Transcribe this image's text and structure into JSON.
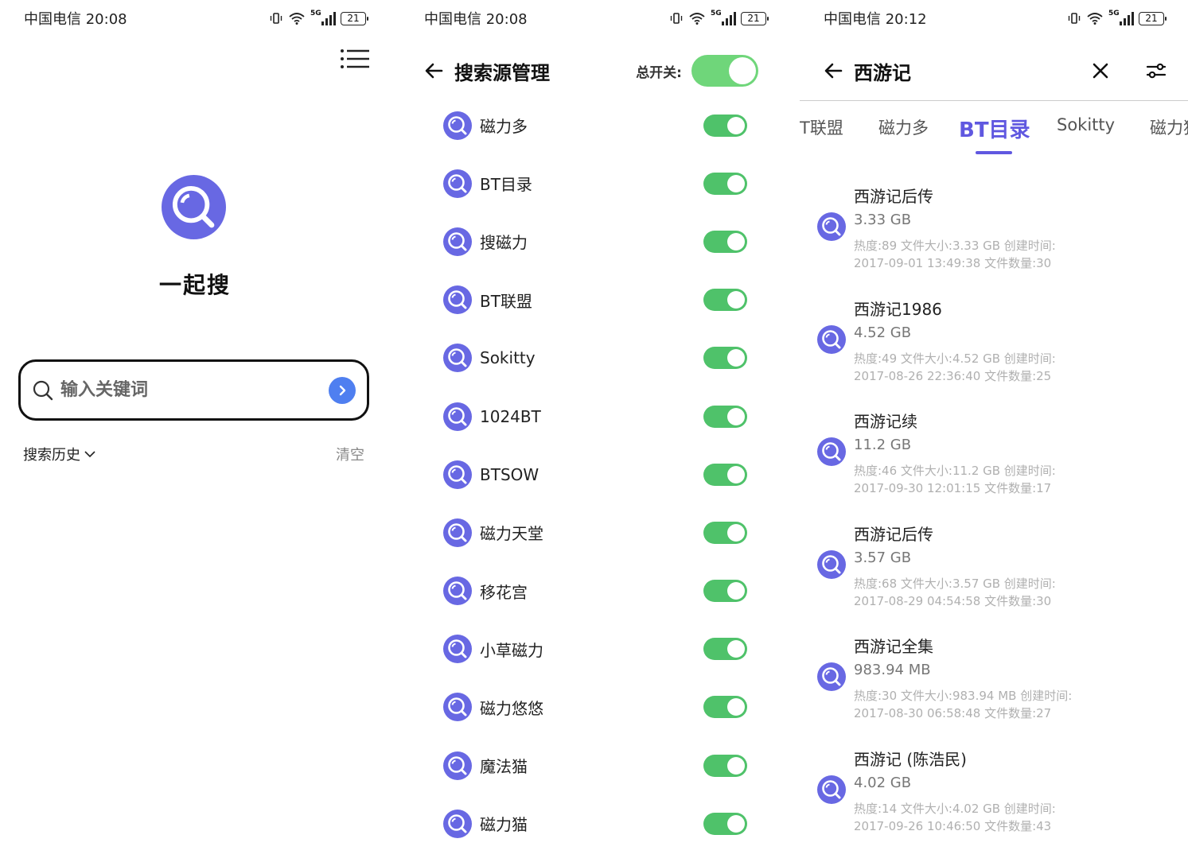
{
  "screens": [
    {
      "status": {
        "carrier": "中国电信 20:08",
        "battery": "21"
      },
      "app_title": "一起搜",
      "search": {
        "placeholder": "输入关键词"
      },
      "history_label": "搜索历史",
      "clear_label": "清空"
    },
    {
      "status": {
        "carrier": "中国电信 20:08",
        "battery": "21"
      },
      "title": "搜索源管理",
      "master_switch_label": "总开关:",
      "master_switch_on": true,
      "sources": [
        {
          "name": "磁力多",
          "enabled": true
        },
        {
          "name": "BT目录",
          "enabled": true
        },
        {
          "name": "搜磁力",
          "enabled": true
        },
        {
          "name": "BT联盟",
          "enabled": true
        },
        {
          "name": "Sokitty",
          "enabled": true
        },
        {
          "name": "1024BT",
          "enabled": true
        },
        {
          "name": "BTSOW",
          "enabled": true
        },
        {
          "name": "磁力天堂",
          "enabled": true
        },
        {
          "name": "移花宫",
          "enabled": true
        },
        {
          "name": "小草磁力",
          "enabled": true
        },
        {
          "name": "磁力悠悠",
          "enabled": true
        },
        {
          "name": "魔法猫",
          "enabled": true
        },
        {
          "name": "磁力猫",
          "enabled": true
        }
      ]
    },
    {
      "status": {
        "carrier": "中国电信 20:12",
        "battery": "21"
      },
      "query": "西游记",
      "tabs": [
        {
          "label": "T联盟"
        },
        {
          "label": "磁力多"
        },
        {
          "label": "BT目录",
          "active": true
        },
        {
          "label": "Sokitty"
        },
        {
          "label": "磁力猫"
        }
      ],
      "results": [
        {
          "title": "西游记后传",
          "size": "3.33 GB",
          "meta1": "热度:89  文件大小:3.33 GB  创建时间:",
          "meta2": "2017-09-01 13:49:38  文件数量:30"
        },
        {
          "title": "西游记1986",
          "size": "4.52 GB",
          "meta1": "热度:49  文件大小:4.52 GB  创建时间:",
          "meta2": "2017-08-26 22:36:40  文件数量:25"
        },
        {
          "title": "西游记续",
          "size": "11.2 GB",
          "meta1": "热度:46  文件大小:11.2 GB  创建时间:",
          "meta2": "2017-09-30 12:01:15  文件数量:17"
        },
        {
          "title": "西游记后传",
          "size": "3.57 GB",
          "meta1": "热度:68  文件大小:3.57 GB  创建时间:",
          "meta2": "2017-08-29 04:54:58  文件数量:30"
        },
        {
          "title": "西游记全集",
          "size": "983.94 MB",
          "meta1": "热度:30  文件大小:983.94 MB  创建时间:",
          "meta2": "2017-08-30 06:58:48  文件数量:27"
        },
        {
          "title": "西游记 (陈浩民)",
          "size": "4.02 GB",
          "meta1": "热度:14  文件大小:4.02 GB  创建时间:",
          "meta2": "2017-09-26 10:46:50  文件数量:43"
        }
      ]
    }
  ],
  "colors": {
    "accent": "#6058e0",
    "icon_bg": "#6868e3",
    "toggle_on": "#4fc26a",
    "go_button": "#4f7ff0"
  },
  "icons": {
    "app_logo": "magnifier-icon",
    "source": "magnifier-icon",
    "menu": "list-menu-icon",
    "back": "arrow-left-icon",
    "close": "close-icon",
    "filter": "sliders-icon"
  }
}
